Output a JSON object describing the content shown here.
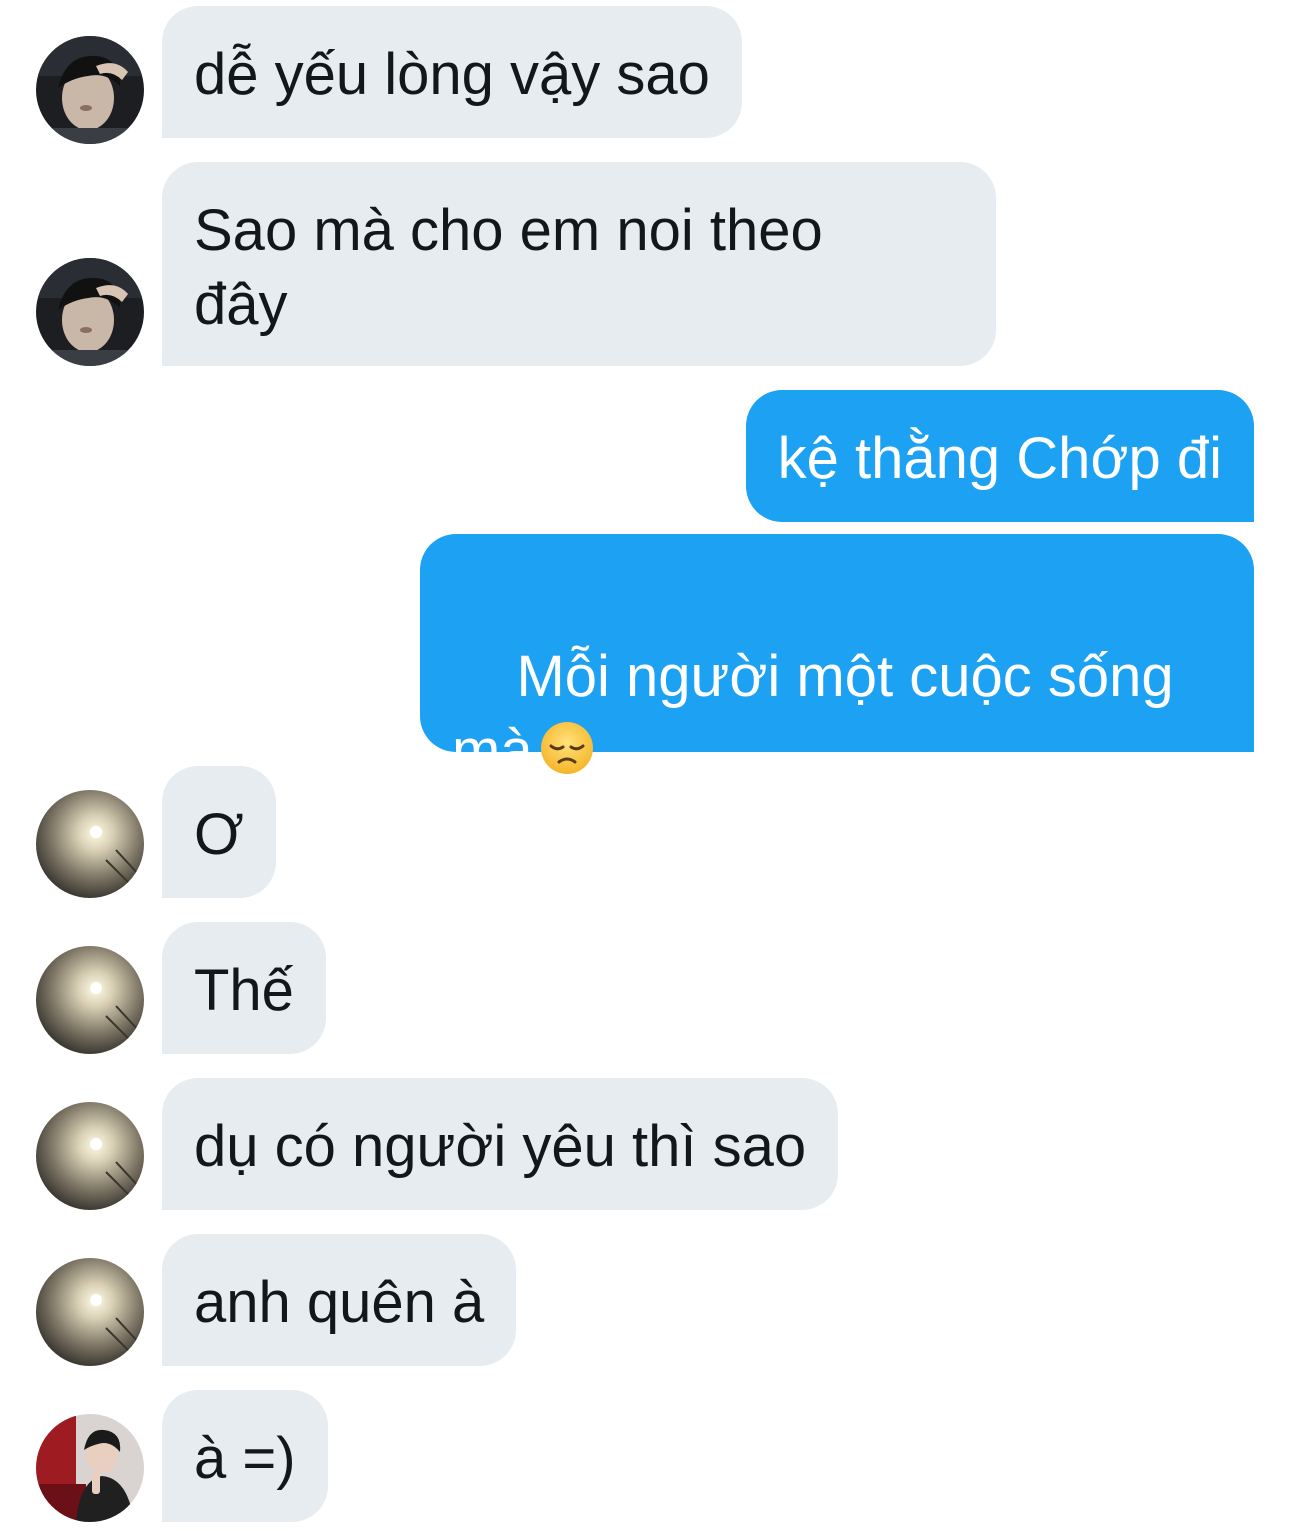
{
  "conversation": {
    "messages": [
      {
        "sender": "them",
        "avatar": "avatar-boy-hand-on-head",
        "text": "dễ yếu lòng vậy sao"
      },
      {
        "sender": "them",
        "avatar": "avatar-boy-hand-on-head",
        "text": "Sao mà cho em noi theo\nđây"
      },
      {
        "sender": "me",
        "text": "kệ thằng Chớp đi"
      },
      {
        "sender": "me",
        "text": "Mỗi người một cuộc sống\nmà",
        "emoji": "disappointed-face-emoji"
      },
      {
        "sender": "them",
        "avatar": "avatar-blurred-light",
        "text": "Ơ"
      },
      {
        "sender": "them",
        "avatar": "avatar-blurred-light",
        "text": "Thế"
      },
      {
        "sender": "them",
        "avatar": "avatar-blurred-light",
        "text": "dụ có người yêu thì sao"
      },
      {
        "sender": "them",
        "avatar": "avatar-blurred-light",
        "text": "anh quên à"
      },
      {
        "sender": "them",
        "avatar": "avatar-boy-red-background",
        "text": "à =)"
      }
    ]
  },
  "colors": {
    "incoming_bubble": "#e6ecf0",
    "outgoing_bubble": "#1da1f2",
    "incoming_text": "#14171a",
    "outgoing_text": "#ffffff"
  }
}
